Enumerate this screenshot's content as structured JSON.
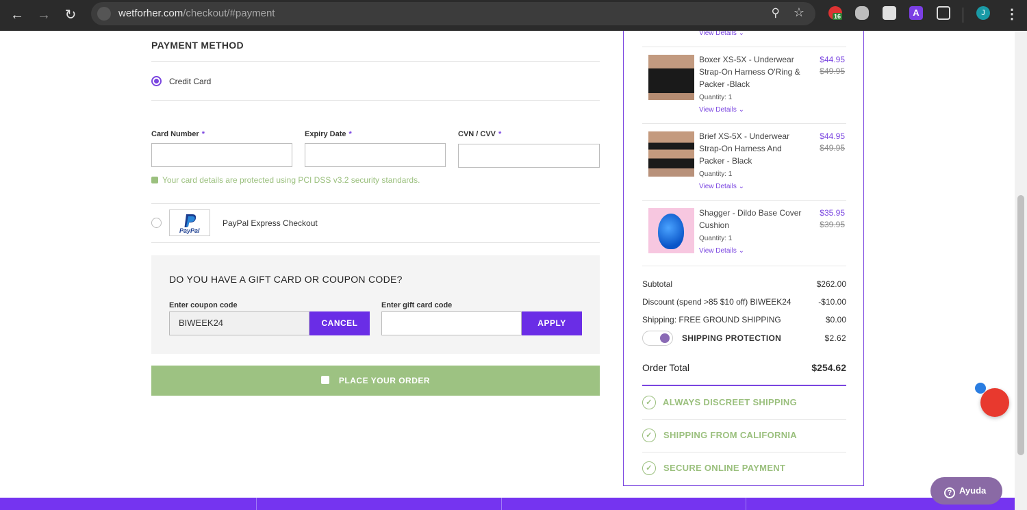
{
  "browser": {
    "url_domain": "wetforher.com",
    "url_path": "/checkout/#payment",
    "ext_badge": "16",
    "profile_initial": "J"
  },
  "payment": {
    "heading": "PAYMENT METHOD",
    "credit_card_label": "Credit Card",
    "card_number_label": "Card Number",
    "expiry_label": "Expiry Date",
    "cvv_label": "CVN / CVV",
    "required_mark": "*",
    "secure_note": "Your card details are protected using PCI DSS v3.2 security standards.",
    "paypal_label": "PayPal Express Checkout",
    "paypal_logo_text": "PayPal"
  },
  "coupon": {
    "heading": "DO YOU HAVE A GIFT CARD OR COUPON CODE?",
    "coupon_label": "Enter coupon code",
    "coupon_value": "BIWEEK24",
    "cancel_label": "CANCEL",
    "gift_label": "Enter gift card code",
    "gift_value": "",
    "apply_label": "APPLY"
  },
  "place_order_label": "PLACE YOUR ORDER",
  "summary": {
    "top_view_details": "View Details",
    "items": [
      {
        "name": "Boxer XS-5X - Underwear Strap-On Harness O'Ring & Packer -Black",
        "qty": "Quantity: 1",
        "view": "View Details",
        "price": "$44.95",
        "original": "$49.95"
      },
      {
        "name": "Brief XS-5X - Underwear Strap-On Harness And Packer - Black",
        "qty": "Quantity: 1",
        "view": "View Details",
        "price": "$44.95",
        "original": "$49.95"
      },
      {
        "name": "Shagger - Dildo Base Cover Cushion",
        "qty": "Quantity: 1",
        "view": "View Details",
        "price": "$35.95",
        "original": "$39.95"
      }
    ],
    "subtotal_label": "Subtotal",
    "subtotal_value": "$262.00",
    "discount_label": "Discount (spend >85 $10 off) BIWEEK24",
    "discount_value": "-$10.00",
    "shipping_label": "Shipping: FREE GROUND SHIPPING",
    "shipping_value": "$0.00",
    "protection_label": "SHIPPING PROTECTION",
    "protection_value": "$2.62",
    "total_label": "Order Total",
    "total_value": "$254.62",
    "badges": [
      "ALWAYS DISCREET SHIPPING",
      "SHIPPING FROM CALIFORNIA",
      "SECURE ONLINE PAYMENT"
    ]
  },
  "help_label": "Ayuda",
  "colors": {
    "accent": "#7a45e0",
    "button": "#6a2de6",
    "green": "#9dc282"
  }
}
